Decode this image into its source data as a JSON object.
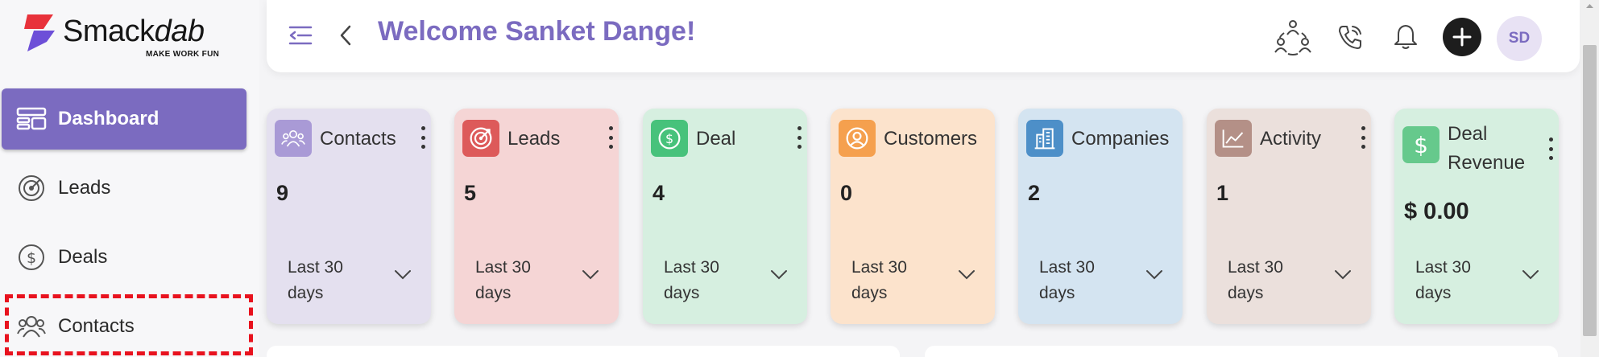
{
  "brand": {
    "name_part1": "Smack",
    "name_part2": "dab",
    "tagline": "MAKE WORK FUN",
    "colors": {
      "red": "#e8323b",
      "purple": "#6d4fd8"
    }
  },
  "sidebar": {
    "items": [
      {
        "label": "Dashboard",
        "icon": "dashboard-icon",
        "active": true
      },
      {
        "label": "Leads",
        "icon": "target-icon",
        "active": false
      },
      {
        "label": "Deals",
        "icon": "dollar-icon",
        "active": false
      },
      {
        "label": "Contacts",
        "icon": "people-icon",
        "active": false,
        "highlighted": true
      }
    ],
    "accent": "#7b6bc0"
  },
  "header": {
    "title": "Welcome Sanket Dange!",
    "avatar_initials": "SD",
    "icons": [
      "collapse-menu-icon",
      "back-icon",
      "team-icon",
      "phone-icon",
      "bell-icon",
      "plus-icon"
    ]
  },
  "cards": [
    {
      "title": "Contacts",
      "value": "9",
      "period": "Last 30 days",
      "bg": "#e4e0ef",
      "icon_bg": "#a99ad6",
      "icon": "people-icon"
    },
    {
      "title": "Leads",
      "value": "5",
      "period": "Last 30 days",
      "bg": "#f5d5d5",
      "icon_bg": "#dd5a5a",
      "icon": "target-icon"
    },
    {
      "title": "Deal",
      "value": "4",
      "period": "Last 30 days",
      "bg": "#d6efe0",
      "icon_bg": "#47c27b",
      "icon": "dollar-icon"
    },
    {
      "title": "Customers",
      "value": "0",
      "period": "Last 30 days",
      "bg": "#fce3cc",
      "icon_bg": "#f5a04e",
      "icon": "user-circle-icon"
    },
    {
      "title": "Companies",
      "value": "2",
      "period": "Last 30 days",
      "bg": "#d4e4f1",
      "icon_bg": "#4d8fc8",
      "icon": "building-icon"
    },
    {
      "title": "Activity",
      "value": "1",
      "period": "Last 30 days",
      "bg": "#ebe0dc",
      "icon_bg": "#b49087",
      "icon": "chart-line-icon"
    },
    {
      "title": "Deal Revenue",
      "value": "$ 0.00",
      "period": "Last 30 days",
      "bg": "#d6efe0",
      "icon_bg": "#66c98c",
      "icon": "dollar-icon"
    }
  ]
}
